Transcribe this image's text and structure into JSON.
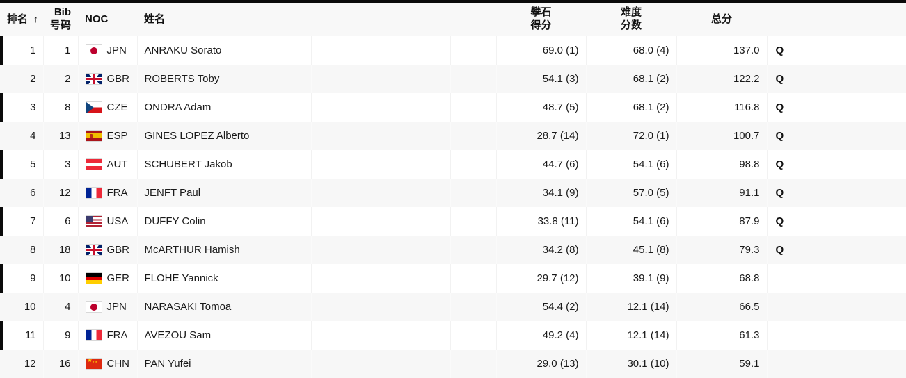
{
  "table": {
    "columns": {
      "rank": "排名",
      "rank_sort_indicator": "↑",
      "bib_line1": "Bib",
      "bib_line2": "号码",
      "noc": "NOC",
      "name": "姓名",
      "blank1": "",
      "blank2": "",
      "boulder_line1": "攀石",
      "boulder_line2": "得分",
      "lead_line1": "难度",
      "lead_line2": "分数",
      "total": "总分",
      "qual": ""
    },
    "rows": [
      {
        "rank": "1",
        "bib": "1",
        "noc": "JPN",
        "flag": "flag-JPN",
        "name": "ANRAKU Sorato",
        "boulder": "69.0 (1)",
        "lead": "68.0 (4)",
        "total": "137.0",
        "qual": "Q"
      },
      {
        "rank": "2",
        "bib": "2",
        "noc": "GBR",
        "flag": "flag-GBR",
        "name": "ROBERTS Toby",
        "boulder": "54.1 (3)",
        "lead": "68.1 (2)",
        "total": "122.2",
        "qual": "Q"
      },
      {
        "rank": "3",
        "bib": "8",
        "noc": "CZE",
        "flag": "flag-CZE",
        "name": "ONDRA Adam",
        "boulder": "48.7 (5)",
        "lead": "68.1 (2)",
        "total": "116.8",
        "qual": "Q"
      },
      {
        "rank": "4",
        "bib": "13",
        "noc": "ESP",
        "flag": "flag-ESP",
        "name": "GINES LOPEZ Alberto",
        "boulder": "28.7 (14)",
        "lead": "72.0 (1)",
        "total": "100.7",
        "qual": "Q"
      },
      {
        "rank": "5",
        "bib": "3",
        "noc": "AUT",
        "flag": "flag-AUT",
        "name": "SCHUBERT Jakob",
        "boulder": "44.7 (6)",
        "lead": "54.1 (6)",
        "total": "98.8",
        "qual": "Q"
      },
      {
        "rank": "6",
        "bib": "12",
        "noc": "FRA",
        "flag": "flag-FRA",
        "name": "JENFT Paul",
        "boulder": "34.1 (9)",
        "lead": "57.0 (5)",
        "total": "91.1",
        "qual": "Q"
      },
      {
        "rank": "7",
        "bib": "6",
        "noc": "USA",
        "flag": "flag-USA",
        "name": "DUFFY Colin",
        "boulder": "33.8 (11)",
        "lead": "54.1 (6)",
        "total": "87.9",
        "qual": "Q"
      },
      {
        "rank": "8",
        "bib": "18",
        "noc": "GBR",
        "flag": "flag-GBR",
        "name": "McARTHUR Hamish",
        "boulder": "34.2 (8)",
        "lead": "45.1 (8)",
        "total": "79.3",
        "qual": "Q"
      },
      {
        "rank": "9",
        "bib": "10",
        "noc": "GER",
        "flag": "flag-GER",
        "name": "FLOHE Yannick",
        "boulder": "29.7 (12)",
        "lead": "39.1 (9)",
        "total": "68.8",
        "qual": ""
      },
      {
        "rank": "10",
        "bib": "4",
        "noc": "JPN",
        "flag": "flag-JPN",
        "name": "NARASAKI Tomoa",
        "boulder": "54.4 (2)",
        "lead": "12.1 (14)",
        "total": "66.5",
        "qual": ""
      },
      {
        "rank": "11",
        "bib": "9",
        "noc": "FRA",
        "flag": "flag-FRA",
        "name": "AVEZOU Sam",
        "boulder": "49.2 (4)",
        "lead": "12.1 (14)",
        "total": "61.3",
        "qual": ""
      },
      {
        "rank": "12",
        "bib": "16",
        "noc": "CHN",
        "flag": "flag-CHN",
        "name": "PAN Yufei",
        "boulder": "29.0 (13)",
        "lead": "30.1 (10)",
        "total": "59.1",
        "qual": ""
      }
    ]
  }
}
